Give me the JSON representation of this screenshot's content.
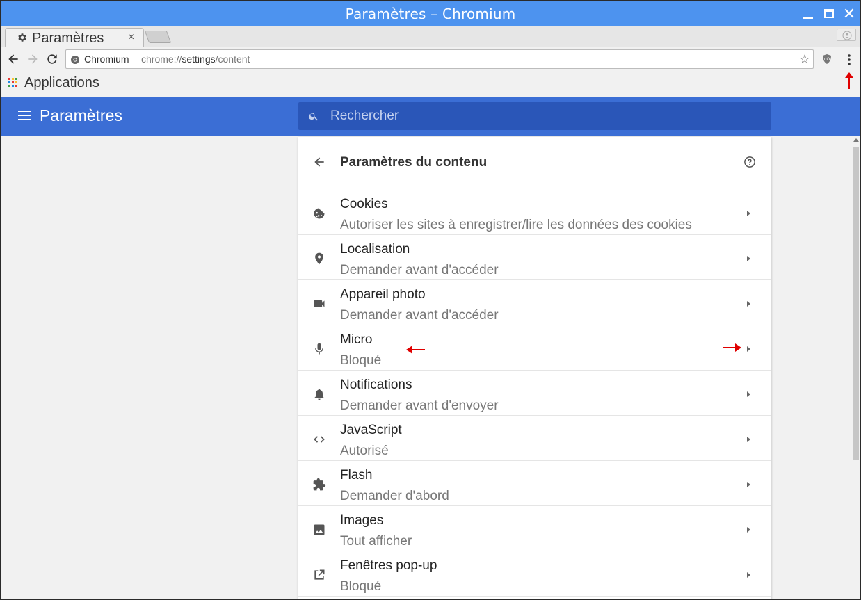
{
  "window": {
    "title": "Paramètres – Chromium"
  },
  "tab": {
    "label": "Paramètres",
    "close": "×"
  },
  "toolbar": {
    "site_name": "Chromium",
    "url_scheme": "chrome://",
    "url_host": "settings",
    "url_path": "/content"
  },
  "bookmarks": {
    "apps_label": "Applications"
  },
  "settings": {
    "title": "Paramètres",
    "search_placeholder": "Rechercher"
  },
  "card": {
    "title": "Paramètres du contenu",
    "rows": [
      {
        "label": "Cookies",
        "sub": "Autoriser les sites à enregistrer/lire les données des cookies",
        "icon": "cookie-icon"
      },
      {
        "label": "Localisation",
        "sub": "Demander avant d'accéder",
        "icon": "location-pin-icon"
      },
      {
        "label": "Appareil photo",
        "sub": "Demander avant d'accéder",
        "icon": "video-camera-icon"
      },
      {
        "label": "Micro",
        "sub": "Bloqué",
        "icon": "microphone-icon"
      },
      {
        "label": "Notifications",
        "sub": "Demander avant d'envoyer",
        "icon": "bell-icon"
      },
      {
        "label": "JavaScript",
        "sub": "Autorisé",
        "icon": "code-icon"
      },
      {
        "label": "Flash",
        "sub": "Demander d'abord",
        "icon": "puzzle-icon"
      },
      {
        "label": "Images",
        "sub": "Tout afficher",
        "icon": "image-icon"
      },
      {
        "label": "Fenêtres pop-up",
        "sub": "Bloqué",
        "icon": "open-in-new-icon"
      }
    ]
  },
  "colors": {
    "titlebar": "#4d93ef",
    "settings_header": "#3b6ed5",
    "search_box": "#2a56b8",
    "annotation_red": "#e00000"
  }
}
